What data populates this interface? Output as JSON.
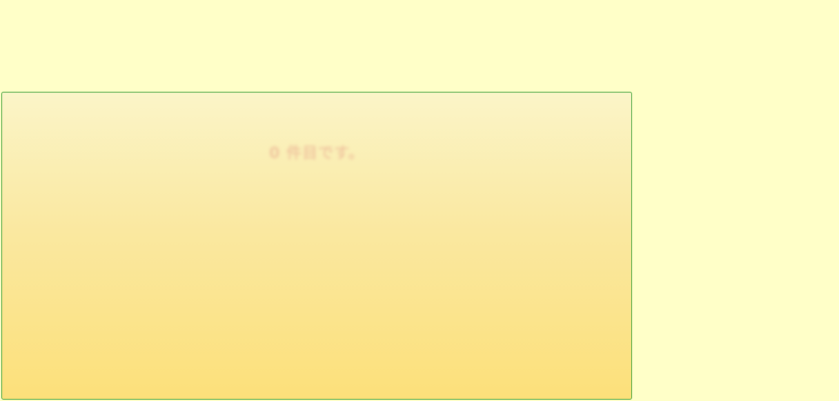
{
  "panel": {
    "message": "0 件目です。"
  },
  "colors": {
    "page_background": "#ffffc8",
    "panel_border": "#2e9a2e",
    "panel_gradient_top": "#fbf5c8",
    "panel_gradient_bottom": "#fce07a",
    "message_text": "#f0c8a0"
  }
}
